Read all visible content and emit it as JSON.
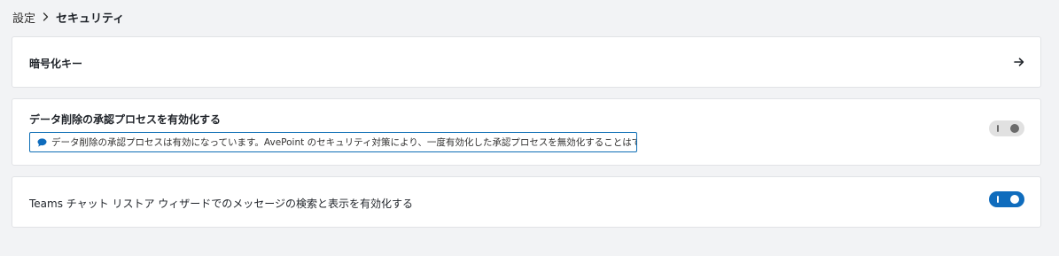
{
  "breadcrumb": {
    "parent": "設定",
    "current": "セキュリティ",
    "separator_icon": "chevron-right-icon"
  },
  "settings": {
    "encryption": {
      "title": "暗号化キー",
      "action_icon": "arrow-right-icon"
    },
    "deletion_approval": {
      "title": "データ削除の承認プロセスを有効化する",
      "info_icon": "chat-bubble-icon",
      "info_text": "データ削除の承認プロセスは有効になっています。AvePoint のセキュリティ対策により、一度有効化した承認プロセスを無効化することはできません。",
      "toggle_state": "off-disabled"
    },
    "teams_chat": {
      "title": "Teams チャット リストア ウィザードでのメッセージの検索と表示を有効化する",
      "toggle_state": "on"
    }
  },
  "colors": {
    "accent": "#0f6cbd",
    "info_border": "#0e6eb5",
    "toggle_off": "#e1e1e1",
    "background": "#f2f3f5"
  }
}
